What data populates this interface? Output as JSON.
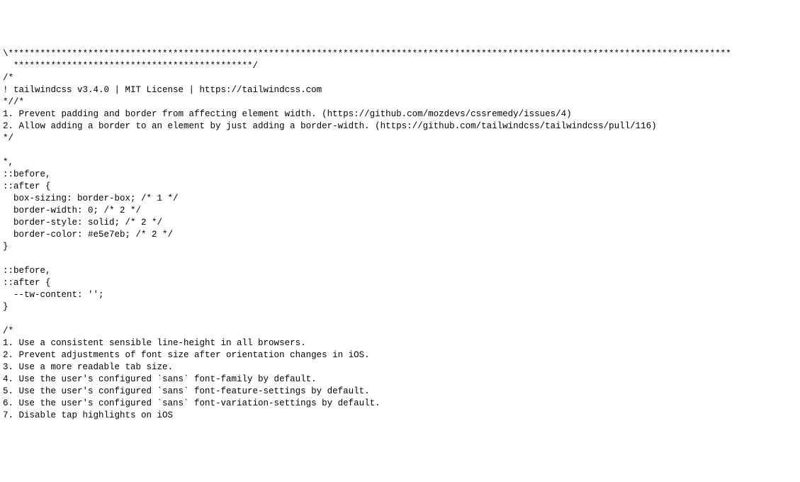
{
  "lines": [
    "\\****************************************************************************************************************************************",
    "  *********************************************/",
    "/*",
    "! tailwindcss v3.4.0 | MIT License | https://tailwindcss.com",
    "*//*",
    "1. Prevent padding and border from affecting element width. (https://github.com/mozdevs/cssremedy/issues/4)",
    "2. Allow adding a border to an element by just adding a border-width. (https://github.com/tailwindcss/tailwindcss/pull/116)",
    "*/",
    "",
    "*,",
    "::before,",
    "::after {",
    "  box-sizing: border-box; /* 1 */",
    "  border-width: 0; /* 2 */",
    "  border-style: solid; /* 2 */",
    "  border-color: #e5e7eb; /* 2 */",
    "}",
    "",
    "::before,",
    "::after {",
    "  --tw-content: '';",
    "}",
    "",
    "/*",
    "1. Use a consistent sensible line-height in all browsers.",
    "2. Prevent adjustments of font size after orientation changes in iOS.",
    "3. Use a more readable tab size.",
    "4. Use the user's configured `sans` font-family by default.",
    "5. Use the user's configured `sans` font-feature-settings by default.",
    "6. Use the user's configured `sans` font-variation-settings by default.",
    "7. Disable tap highlights on iOS"
  ]
}
